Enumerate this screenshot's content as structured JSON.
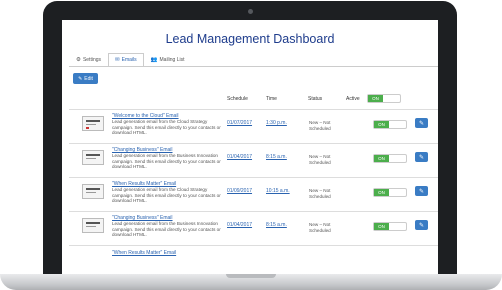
{
  "dashboard": {
    "title": "Lead Management Dashboard"
  },
  "tabs": [
    {
      "label": "Settings",
      "icon": "gear-icon"
    },
    {
      "label": "Emails",
      "icon": "envelope-icon",
      "active": true
    },
    {
      "label": "Mailing List",
      "icon": "users-icon"
    }
  ],
  "toolbar": {
    "edit_label": "Edit"
  },
  "table": {
    "headers": {
      "schedule": "Schedule",
      "time": "Time",
      "status": "Status",
      "active": "Active"
    },
    "master_toggle": "ON",
    "rows": [
      {
        "title": "\"Welcome to the Cloud\" Email",
        "description": "Lead generation email from the Cloud Strategy campaign. Send this email directly to your contacts or download HTML.",
        "date": "01/07/2017",
        "time": "1:30 p.m.",
        "status": "New – Not Scheduled",
        "toggle": "ON"
      },
      {
        "title": "\"Changing Business\" Email",
        "description": "Lead generation email from the Business Innovation campaign. Send this email directly to your contacts or download HTML.",
        "date": "01/04/2017",
        "time": "8:15 a.m.",
        "status": "New – Not Scheduled",
        "toggle": "ON"
      },
      {
        "title": "\"When Results Matter\" Email",
        "description": "Lead generation email from the Cloud Strategy campaign. Send this email directly to your contacts or download HTML.",
        "date": "01/09/2017",
        "time": "10:15 a.m.",
        "status": "New – Not Scheduled",
        "toggle": "ON"
      },
      {
        "title": "\"Changing Business\" Email",
        "description": "Lead generation email from the Business Innovation campaign. Send this email directly to your contacts or download HTML.",
        "date": "01/04/2017",
        "time": "8:15 a.m.",
        "status": "New – Not Scheduled",
        "toggle": "ON"
      },
      {
        "title": "\"When Results Matter\" Email",
        "description": "",
        "date": "",
        "time": "",
        "status": "",
        "toggle": ""
      }
    ]
  },
  "colors": {
    "accent": "#3a7cc4",
    "toggle_on": "#4cae4c",
    "title": "#1e3c8c"
  }
}
